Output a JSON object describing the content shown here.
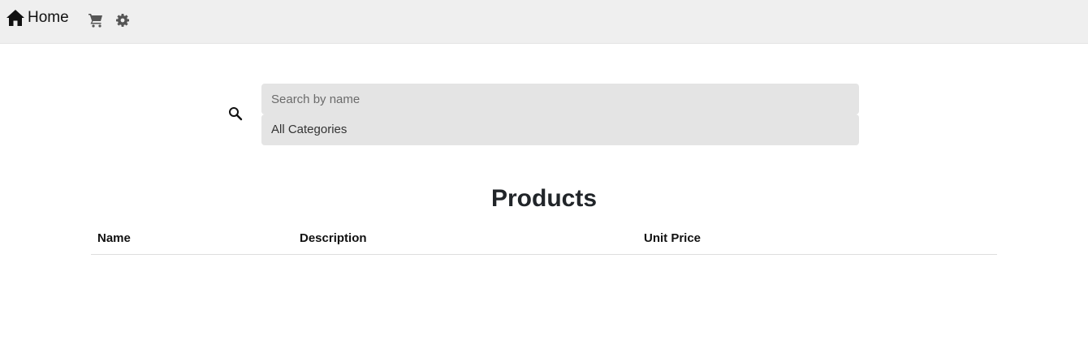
{
  "navbar": {
    "home_label": "Home",
    "home_icon": "home-icon",
    "cart_icon": "cart-icon",
    "settings_icon": "gear-icon"
  },
  "search": {
    "icon": "search-icon",
    "placeholder": "Search by name",
    "value": ""
  },
  "category_filter": {
    "selected": "All Categories"
  },
  "products": {
    "title": "Products",
    "columns": [
      "Name",
      "Description",
      "Unit Price"
    ],
    "rows": []
  }
}
